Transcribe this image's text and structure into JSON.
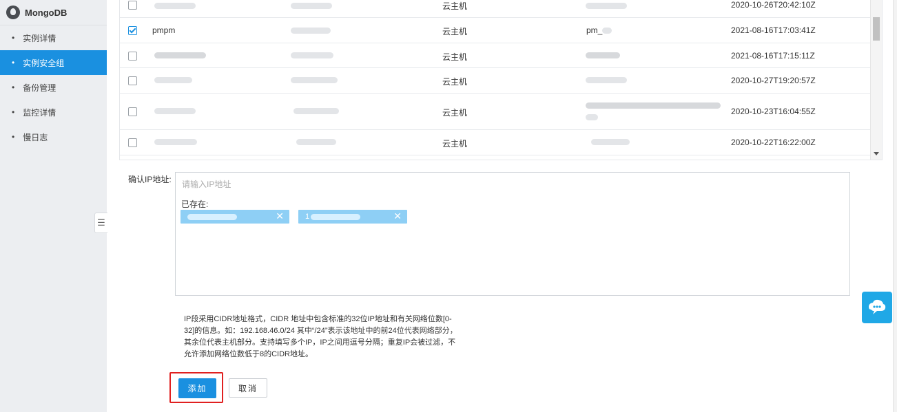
{
  "sidebar": {
    "brand": "MongoDB",
    "items": [
      {
        "label": "实例详情",
        "active": false
      },
      {
        "label": "实例安全组",
        "active": true
      },
      {
        "label": "备份管理",
        "active": false
      },
      {
        "label": "监控详情",
        "active": false
      },
      {
        "label": "慢日志",
        "active": false
      }
    ]
  },
  "table": {
    "rows": [
      {
        "name": "",
        "type": "云主机",
        "ip": "",
        "created": "2020-10-26T20:42:10Z",
        "checked": false
      },
      {
        "name": "pmpm",
        "type": "云主机",
        "ip": "pm_",
        "created": "2021-08-16T17:03:41Z",
        "checked": true
      },
      {
        "name": "",
        "type": "云主机",
        "ip": "",
        "created": "2021-08-16T17:15:11Z",
        "checked": false
      },
      {
        "name": "",
        "type": "云主机",
        "ip": "",
        "created": "2020-10-27T19:20:57Z",
        "checked": false
      },
      {
        "name": "",
        "type": "云主机",
        "ip": "",
        "created": "2020-10-23T16:04:55Z",
        "checked": false
      },
      {
        "name": "",
        "type": "云主机",
        "ip": "",
        "created": "2020-10-22T16:22:00Z",
        "checked": false
      }
    ]
  },
  "form": {
    "ip_label": "确认IP地址:",
    "ip_placeholder": "请输入IP地址",
    "existing_label": "已存在:",
    "tags": [
      {
        "text": ""
      },
      {
        "text": "1"
      }
    ],
    "hint": "IP段采用CIDR地址格式，CIDR 地址中包含标准的32位IP地址和有关网络位数[0-32]的信息。如：192.168.46.0/24 其中“/24”表示该地址中的前24位代表网络部分，其余位代表主机部分。支持填写多个IP，IP之间用逗号分隔；重复IP会被过滤，不允许添加网络位数低于8的CIDR地址。",
    "add_label": "添加",
    "cancel_label": "取消"
  },
  "colors": {
    "accent": "#1a90e0",
    "tag": "#8ecff5",
    "highlight": "#e02020"
  },
  "icons": {
    "brand": "mongodb-logo-icon",
    "tag_remove": "close-icon",
    "collapse": "collapse-menu-icon",
    "float_help": "chat-bubble-icon"
  }
}
